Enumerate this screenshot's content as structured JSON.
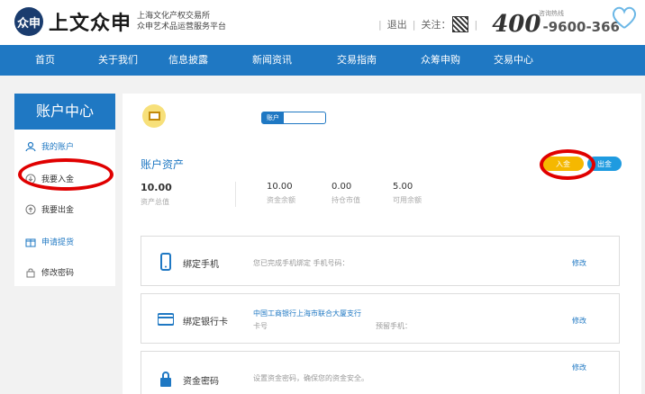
{
  "header": {
    "logo_mark": "众申",
    "brand_name": "上文众申",
    "brand_sub_1": "上海文化产权交易所",
    "brand_sub_2": "众申艺术品运营服务平台",
    "logout": "退出",
    "follow": "关注：",
    "hotline_prefix": "400",
    "hotline_number": "-9600-366",
    "hotline_label": "咨询热线"
  },
  "nav": {
    "items": [
      "首页",
      "关于我们",
      "信息披露",
      "新闻资讯",
      "交易指南",
      "众筹申购",
      "交易中心"
    ]
  },
  "sidebar": {
    "title": "账户中心",
    "items": [
      "我的账户",
      "我要入金",
      "我要出金",
      "申请提货",
      "修改密码"
    ]
  },
  "account": {
    "account_label": "账户",
    "assets_title": "账户资产",
    "deposit_button": "入金",
    "withdraw_button": "出金",
    "stats": [
      {
        "value": "10.00",
        "label": "资产总值"
      },
      {
        "value": "10.00",
        "label": "资金余额"
      },
      {
        "value": "0.00",
        "label": "持仓市值"
      },
      {
        "value": "5.00",
        "label": "可用余额"
      }
    ]
  },
  "cards": {
    "phone": {
      "title": "绑定手机",
      "desc": "您已完成手机绑定 手机号码：",
      "edit": "修改"
    },
    "bank": {
      "title": "绑定银行卡",
      "bank_name": "中国工商银行上海市联合大厦支行",
      "card_no_label": "卡号",
      "phone_label": "预留手机：",
      "edit": "修改"
    },
    "password": {
      "title": "资金密码",
      "desc": "设置资金密码，确保您的资金安全。",
      "edit": "修改"
    }
  }
}
